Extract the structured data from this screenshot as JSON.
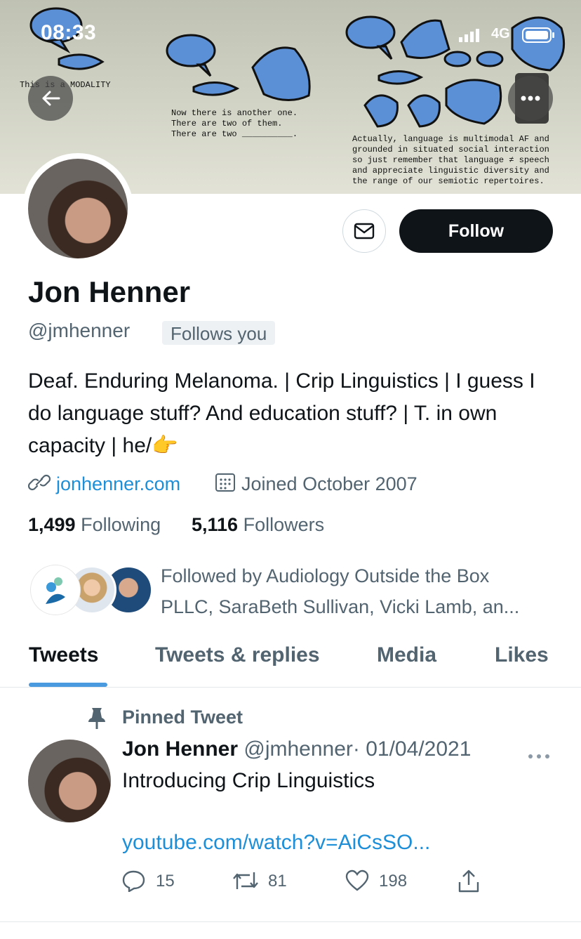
{
  "status_bar": {
    "time": "08:33",
    "network": "4G"
  },
  "banner": {
    "caption_1": "This is a MODALITY",
    "caption_2": [
      "Now there is another one.",
      "There are two of them.",
      "There are two __________."
    ],
    "caption_3": [
      "Actually, language is multimodal AF and",
      "grounded in situated social interaction",
      "so just remember that language ≠ speech",
      "and appreciate linguistic diversity and",
      "the range of our semiotic repertoires."
    ]
  },
  "profile": {
    "name": "Jon Henner",
    "handle": "@jmhenner",
    "follows_you_badge": "Follows you",
    "bio": "Deaf. Enduring Melanoma. | Crip Linguistics | I guess I do language stuff? And education stuff? | T. in own capacity | he/👉",
    "website": "jonhenner.com",
    "joined": "Joined October 2007",
    "following_count": "1,499",
    "following_label": "Following",
    "followers_count": "5,116",
    "followers_label": "Followers",
    "followed_by": [
      "Followed by Audiology Outside the Box",
      "PLLC, SaraBeth Sullivan, Vicki Lamb, an..."
    ]
  },
  "buttons": {
    "follow": "Follow"
  },
  "tabs": [
    {
      "label": "Tweets",
      "active": true
    },
    {
      "label": "Tweets & replies",
      "active": false
    },
    {
      "label": "Media",
      "active": false
    },
    {
      "label": "Likes",
      "active": false
    }
  ],
  "pinned_tweet": {
    "label": "Pinned Tweet",
    "author_name": "Jon Henner",
    "author_handle": "@jmhenner",
    "date": "· 01/04/2021",
    "text": "Introducing Crip Linguistics",
    "link": "youtube.com/watch?v=AiCsSO...",
    "replies": "15",
    "retweets": "81",
    "likes": "198"
  },
  "colors": {
    "accent": "#1d9bf0",
    "follow_button": "#0f1419",
    "muted": "#536471"
  },
  "icons": [
    "back-arrow-icon",
    "more-icon",
    "mail-icon",
    "link-icon",
    "calendar-icon",
    "pin-icon",
    "reply-icon",
    "retweet-icon",
    "like-icon",
    "share-icon"
  ]
}
